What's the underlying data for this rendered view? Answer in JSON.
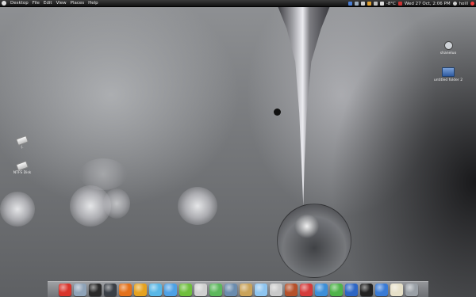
{
  "top_panel": {
    "menus": [
      "Desktop",
      "File",
      "Edit",
      "View",
      "Places",
      "Help"
    ],
    "weather": "-8°C",
    "datetime": "Wed 27 Oct, 2:06 PM",
    "user": "hoill"
  },
  "desktop": {
    "icons_right": [
      {
        "label": "shaneluo",
        "icon": "satellite-dish-icon"
      },
      {
        "label": "untitled folder 2",
        "icon": "folder-icon"
      }
    ],
    "icons_left": [
      {
        "label": "(.",
        "icon": "usb-drive-icon"
      },
      {
        "label": "NTFS Disk",
        "icon": "usb-drive-icon"
      }
    ]
  },
  "dock": {
    "items": [
      {
        "name": "anchor-icon",
        "color": "#d9342b"
      },
      {
        "name": "network-icon",
        "color": "#8fa3b8"
      },
      {
        "name": "monitor-icon",
        "color": "#2a2a2a"
      },
      {
        "name": "tool-icon",
        "color": "#3a3f46"
      },
      {
        "name": "firefox-icon",
        "color": "#e4711a"
      },
      {
        "name": "thunderbird-icon",
        "color": "#e5a220"
      },
      {
        "name": "sound-wave-icon",
        "color": "#58b7e6"
      },
      {
        "name": "weather-icon",
        "color": "#4ea1e5"
      },
      {
        "name": "puzzle-icon",
        "color": "#6fbf3d"
      },
      {
        "name": "joystick-icon",
        "color": "#d0d0d0"
      },
      {
        "name": "download-icon",
        "color": "#5cb85c"
      },
      {
        "name": "globe-icon",
        "color": "#6b8cae"
      },
      {
        "name": "package-icon",
        "color": "#caa35a"
      },
      {
        "name": "cube-icon",
        "color": "#8ec5f0"
      },
      {
        "name": "disc-icon",
        "color": "#c9c9c9"
      },
      {
        "name": "cake-icon",
        "color": "#b5502a"
      },
      {
        "name": "cards-icon",
        "color": "#d53b3b"
      },
      {
        "name": "chat-icon",
        "color": "#3d8fd8"
      },
      {
        "name": "play-icon",
        "color": "#4fb44a"
      },
      {
        "name": "display-icon",
        "color": "#2d66c4"
      },
      {
        "name": "speaker-icon",
        "color": "#222222"
      },
      {
        "name": "drive-icon",
        "color": "#3a7bd5"
      },
      {
        "name": "notes-icon",
        "color": "#e6e0c8"
      },
      {
        "name": "trash-icon",
        "color": "#9aa0a6"
      }
    ]
  }
}
